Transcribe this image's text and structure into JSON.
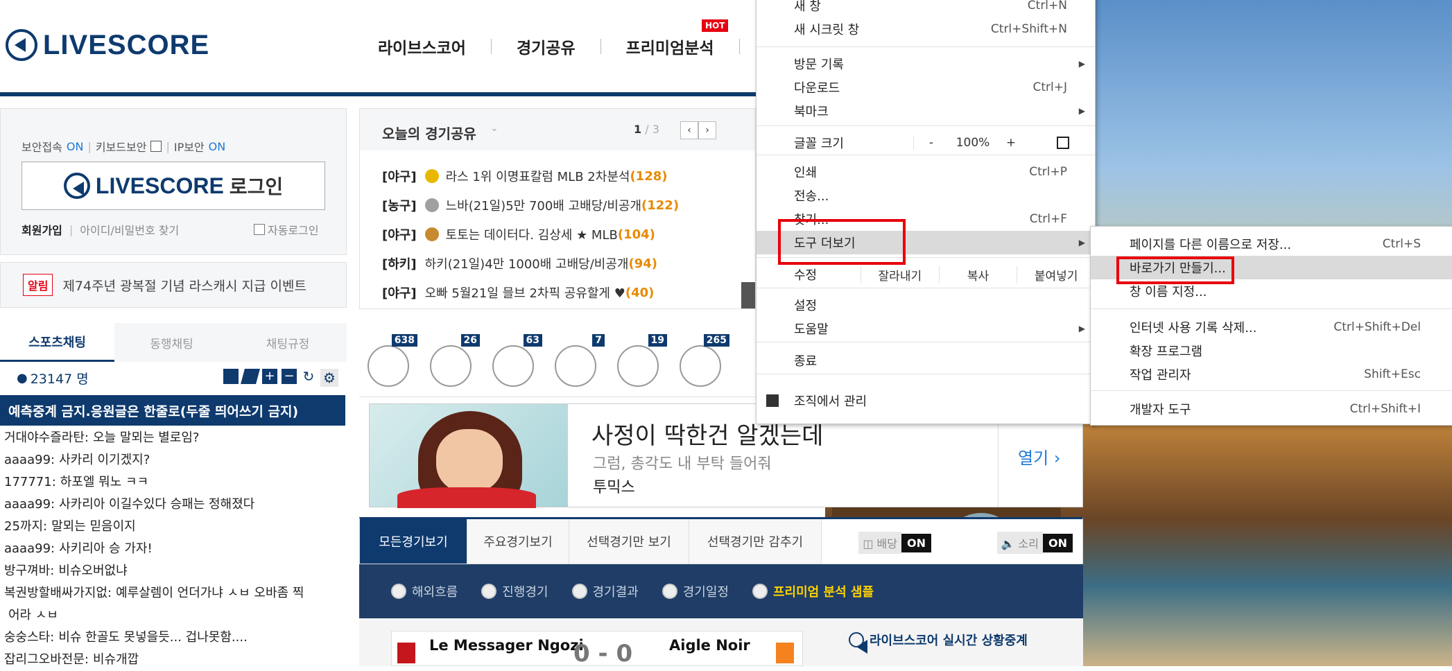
{
  "header": {
    "logo_text": "LIVESCORE",
    "nav": [
      "라이브스코어",
      "경기공유",
      "프리미엄분석"
    ],
    "hot_badge": "HOT"
  },
  "login": {
    "secure_access": "보안접속",
    "secure_access_state": "ON",
    "keyboard_security": "키보드보안",
    "ip_security": "IP보안",
    "ip_security_state": "ON",
    "login_logo": "LIVESCORE",
    "login_suffix": "로그인",
    "signup": "회원가입",
    "find_account": "아이디/비밀번호 찾기",
    "auto_login": "자동로그인"
  },
  "notice": {
    "badge": "알림",
    "text": "제74주년 광복절 기념 라스캐시 지급 이벤트"
  },
  "chat": {
    "tabs": [
      "스포츠채팅",
      "동행채팅",
      "채팅규정"
    ],
    "user_count": "23147 명",
    "banner": "예측중계 금지.응원글은 한줄로(두줄 띄어쓰기 금지)",
    "messages": [
      {
        "nick": "거대야수즐라탄:",
        "text": "오늘 말뫼는 별로임?"
      },
      {
        "nick": "aaaa99:",
        "text": "사카리 이기겠지?"
      },
      {
        "nick": "177771:",
        "text": "하포엘 뭐노 ㅋㅋ"
      },
      {
        "nick": "aaaa99:",
        "text": "사카리아 이길수있다 승패는 정해졌다"
      },
      {
        "nick": "25까지:",
        "text": "말뫼는 믿음이지"
      },
      {
        "nick": "aaaa99:",
        "text": "사키리아 승 가자!"
      },
      {
        "nick": "방구껴바:",
        "text": "비슈오버없냐"
      },
      {
        "nick": "복권방할배싸가지없:",
        "text": "예루살렘이 언더가냐 ㅅㅂ 오바좀 찍"
      },
      {
        "nick": "",
        "text": "어라 ㅅㅂ"
      },
      {
        "nick": "숭숭스타:",
        "text": "비슈 한골도 못넣을듯... 겁나못함...."
      },
      {
        "nick": "잡리그오바전문:",
        "text": "비슈개깝"
      }
    ]
  },
  "share": {
    "title": "오늘의 경기공유",
    "page_current": "1",
    "page_total": "/ 3",
    "rows": [
      {
        "cat": "[야구]",
        "text": "라스 1위 이명표칼럼 MLB 2차분석",
        "count": "(128)",
        "coin": "#e8b800"
      },
      {
        "cat": "[농구]",
        "text": "느바(21일)5만 700배 고배당/비공개",
        "count": "(122)",
        "coin": "#a0a0a0"
      },
      {
        "cat": "[야구]",
        "text": "토토는 데이터다. 김상세 ★ MLB",
        "count": "(104)",
        "coin": "#c88a30"
      },
      {
        "cat": "[하키]",
        "text": "하키(21일)4만 1000배 고배당/비공개",
        "count": "(94)",
        "coin": ""
      },
      {
        "cat": "[야구]",
        "text": "오빠 5월21일 믈브 2차픽 공유할게 ♥",
        "count": "(40)",
        "coin": ""
      }
    ]
  },
  "sports": {
    "counts": [
      "638",
      "26",
      "63",
      "7",
      "19",
      "265"
    ]
  },
  "ad": {
    "headline": "사정이 딱한건 알겠는데",
    "sub": "그럼, 총각도 내 부탁 들어줘",
    "brand": "투믹스",
    "open": "열기"
  },
  "game_tabs": {
    "tabs": [
      "모든경기보기",
      "주요경기보기",
      "선택경기만 보기",
      "선택경기만 감추기"
    ],
    "odds_label": "배당",
    "odds_state": "ON",
    "sound_label": "소리",
    "sound_state": "ON"
  },
  "filters": {
    "options": [
      "해외흐름",
      "진행경기",
      "경기결과",
      "경기일정",
      "프리미엄 분석 샘플"
    ]
  },
  "match": {
    "home": "Le Messager Ngozi",
    "away": "Aigle Noir",
    "score": "0 - 0",
    "live_label": "라이브스코어 실시간 상황중계"
  },
  "main_menu": {
    "items": [
      {
        "label": "새 창",
        "shortcut": "Ctrl+N"
      },
      {
        "label": "새 시크릿 창",
        "shortcut": "Ctrl+Shift+N"
      },
      {
        "label": "방문 기록",
        "shortcut": ""
      },
      {
        "label": "다운로드",
        "shortcut": "Ctrl+J"
      },
      {
        "label": "북마크",
        "shortcut": ""
      },
      {
        "label": "글꼴 크기",
        "shortcut": ""
      },
      {
        "label": "인쇄",
        "shortcut": "Ctrl+P"
      },
      {
        "label": "전송...",
        "shortcut": ""
      },
      {
        "label": "찾기...",
        "shortcut": "Ctrl+F"
      },
      {
        "label": "도구 더보기",
        "shortcut": ""
      },
      {
        "label": "수정",
        "shortcut": ""
      },
      {
        "label": "설정",
        "shortcut": ""
      },
      {
        "label": "도움말",
        "shortcut": ""
      },
      {
        "label": "종료",
        "shortcut": ""
      },
      {
        "label": "조직에서 관리",
        "shortcut": ""
      }
    ],
    "zoom_minus": "-",
    "zoom_value": "100%",
    "zoom_plus": "+",
    "edit_cut": "잘라내기",
    "edit_copy": "복사",
    "edit_paste": "붙여넣기"
  },
  "submenu": {
    "items": [
      {
        "label": "페이지를 다른 이름으로 저장...",
        "shortcut": "Ctrl+S"
      },
      {
        "label": "바로가기 만들기...",
        "shortcut": ""
      },
      {
        "label": "창 이름 지정...",
        "shortcut": ""
      },
      {
        "label": "인터넷 사용 기록 삭제...",
        "shortcut": "Ctrl+Shift+Del"
      },
      {
        "label": "확장 프로그램",
        "shortcut": ""
      },
      {
        "label": "작업 관리자",
        "shortcut": "Shift+Esc"
      },
      {
        "label": "개발자 도구",
        "shortcut": "Ctrl+Shift+I"
      }
    ]
  },
  "colors": {
    "brand_navy": "#0e3a6e",
    "highlight_red": "#e8000b",
    "count_orange": "#e88a00",
    "link_blue": "#1e78d4"
  }
}
